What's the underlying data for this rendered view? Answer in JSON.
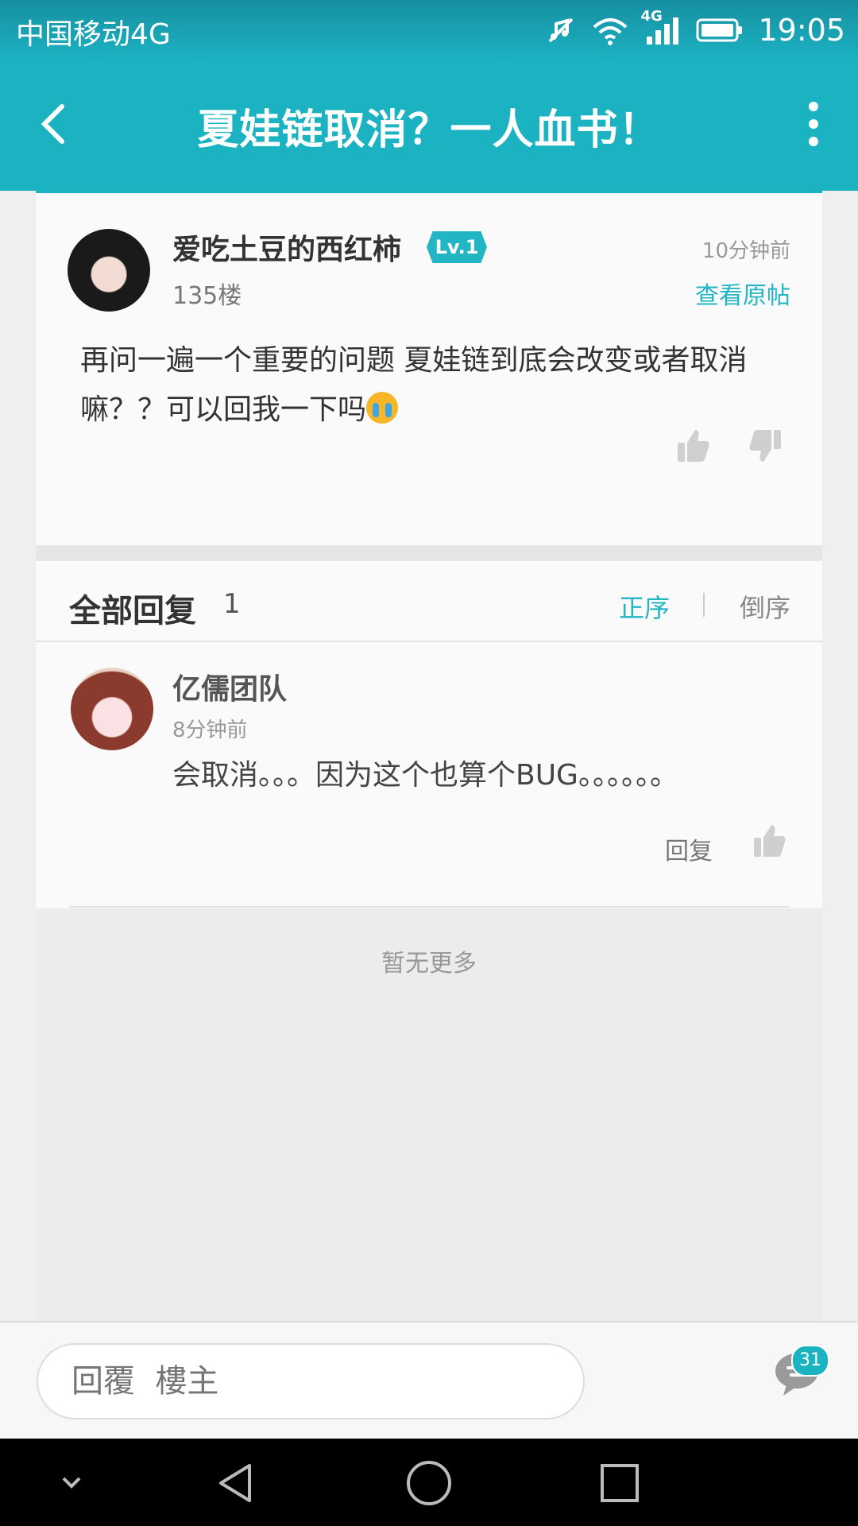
{
  "status_bar": {
    "carrier": "中国移动4G",
    "network_label": "4G",
    "time": "19:05"
  },
  "header": {
    "title": "夏娃链取消？一人血书！"
  },
  "post": {
    "author": "爱吃土豆的西红柿",
    "level": "Lv.1",
    "floor": "135楼",
    "time": "10分钟前",
    "view_original": "查看原帖",
    "text": "再问一遍一个重要的问题 夏娃链到底会改变或者取消嘛？？可以回我一下吗"
  },
  "replies": {
    "title": "全部回复",
    "count": "1",
    "sort_asc": "正序",
    "sort_desc": "倒序",
    "items": [
      {
        "author": "亿儒团队",
        "time": "8分钟前",
        "text": "会取消。。。因为这个也算个BUG。。。。。。",
        "reply_label": "回复"
      }
    ],
    "no_more": "暂无更多"
  },
  "bottom_bar": {
    "placeholder": "回覆  樓主",
    "comment_count": "31"
  },
  "colors": {
    "accent": "#1bb2c2"
  }
}
